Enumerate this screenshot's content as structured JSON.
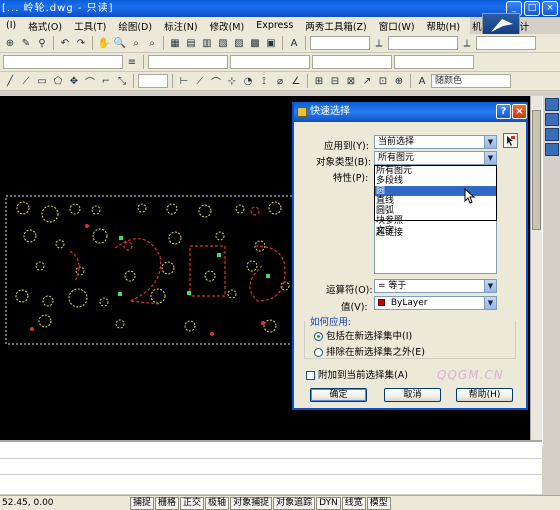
{
  "window": {
    "title": "[... 岭轮.dwg - 只读]"
  },
  "menu": [
    "(I)",
    "格式(O)",
    "工具(T)",
    "绘图(D)",
    "标注(N)",
    "修改(M)",
    "Express",
    "两秀工具箱(Z)",
    "窗口(W)",
    "帮助(H)",
    "机械零件设计"
  ],
  "toolbar3": {
    "layer_dropdown": "随颜色"
  },
  "dialog": {
    "title": "快速选择",
    "help_label": "?",
    "close_label": "×",
    "apply_to_label": "应用到(Y):",
    "apply_to_value": "当前选择",
    "object_type_label": "对象类型(B):",
    "object_type_value": "所有图元",
    "object_type_options": [
      "所有图元",
      "多段线",
      "圆",
      "直线",
      "圆弧",
      "块参照",
      "文字"
    ],
    "object_type_selected_index": 2,
    "properties_label": "特性(P):",
    "properties_tail": "超链接",
    "operator_label": "运算符(O):",
    "operator_value": "= 等于",
    "value_label": "值(V):",
    "value_value": "ByLayer",
    "value_color": "#cc0000",
    "how_to_apply_title": "如何应用:",
    "radio_include": "包括在新选择集中(I)",
    "radio_exclude": "排除在新选择集之外(E)",
    "append_label": "附加到当前选择集(A)",
    "ok_label": "确定",
    "cancel_label": "取消",
    "help_button_label": "帮助(H)"
  },
  "watermark": "QQGM.CN",
  "status": {
    "coords": "52.45, 0.00",
    "buttons": [
      "捕捉",
      "栅格",
      "正交",
      "极轴",
      "对象捕捉",
      "对象追踪",
      "DYN",
      "线宽",
      "模型"
    ]
  }
}
